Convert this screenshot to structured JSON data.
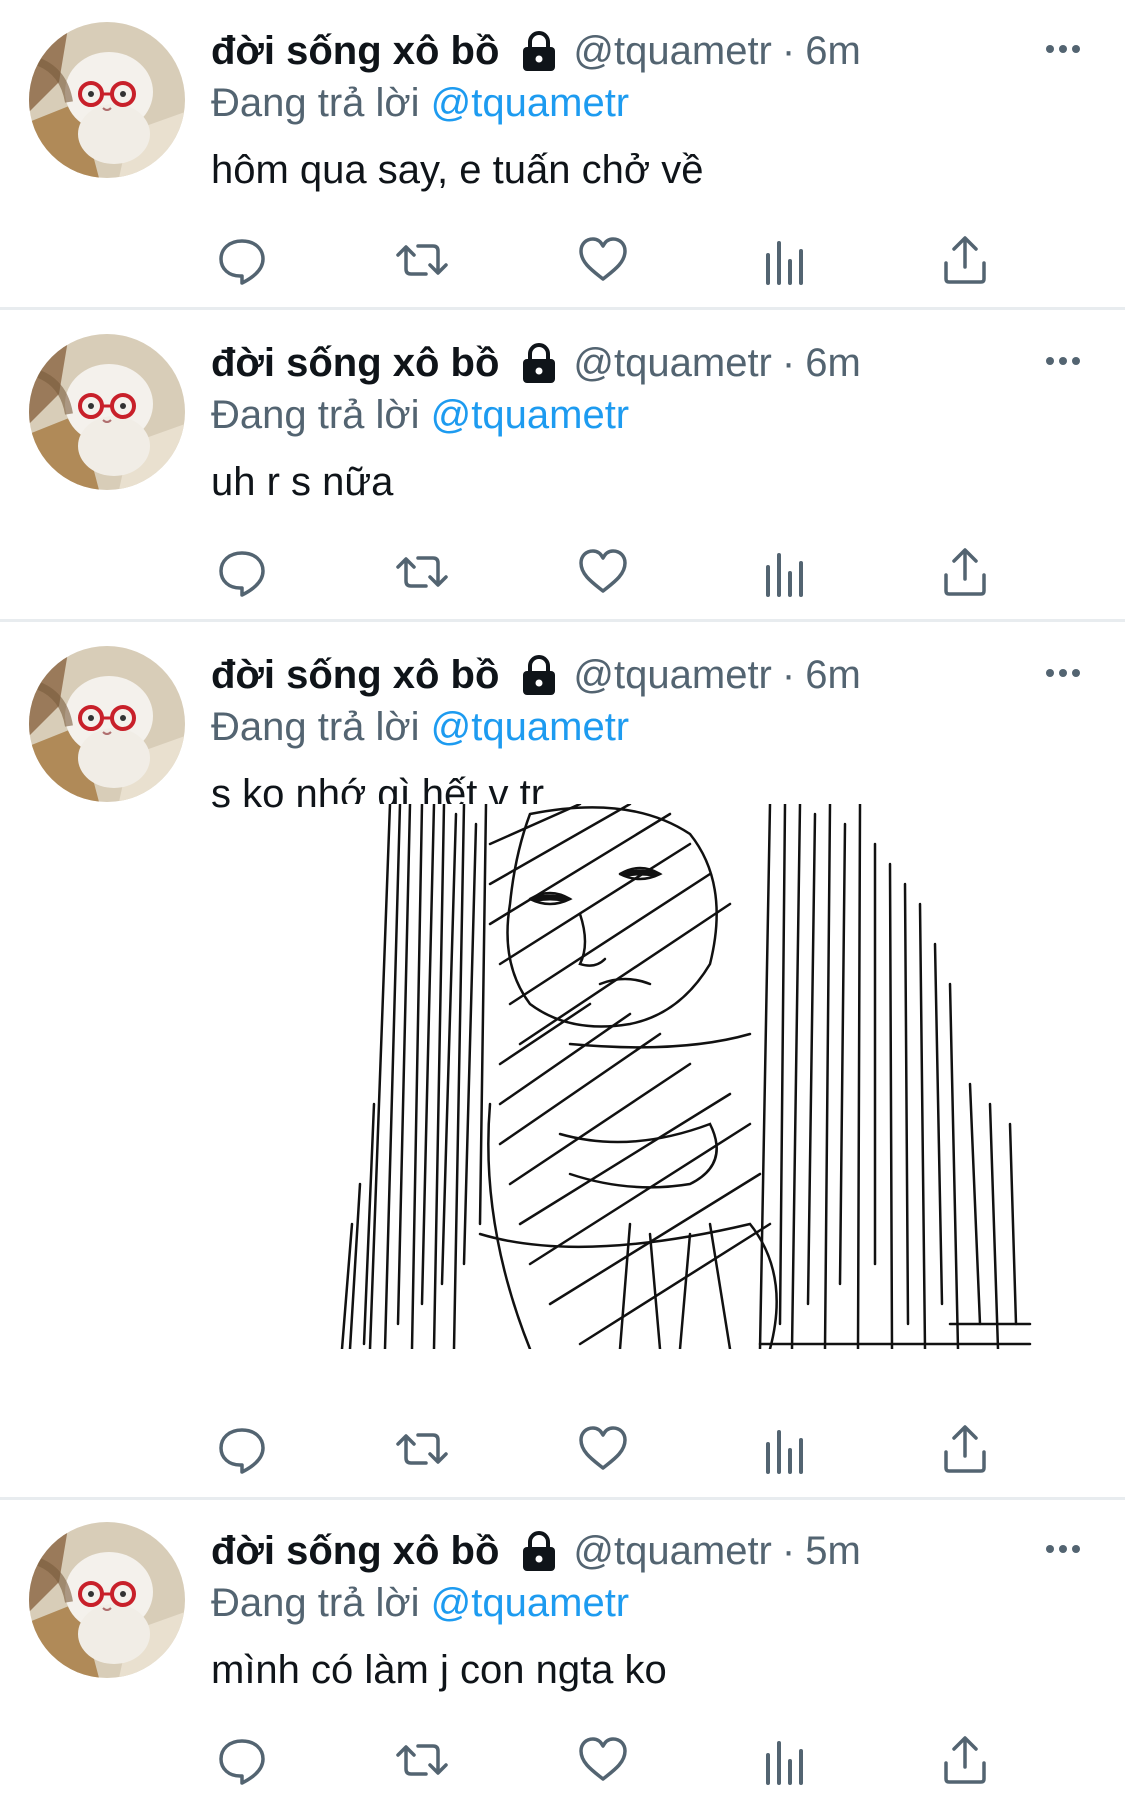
{
  "colors": {
    "text_primary": "#0f1419",
    "text_secondary": "#536471",
    "link_blue": "#1d9bf0",
    "divider": "#e8ecef"
  },
  "icons": {
    "lock": "lock-icon",
    "more": "more-icon",
    "reply": "reply-icon",
    "retweet": "retweet-icon",
    "like": "like-icon",
    "analytics": "analytics-icon",
    "share": "share-icon"
  },
  "tweets": [
    {
      "display_name": "đời sống xô bồ",
      "handle": "@tquametr",
      "separator": "·",
      "time": "6m",
      "reply_label": "Đang trả lời",
      "reply_to": "@tquametr",
      "text": "hôm qua say, e tuấn chở về"
    },
    {
      "display_name": "đời sống xô bồ",
      "handle": "@tquametr",
      "separator": "·",
      "time": "6m",
      "reply_label": "Đang trả lời",
      "reply_to": "@tquametr",
      "text": "uh r s nữa"
    },
    {
      "display_name": "đời sống xô bồ",
      "handle": "@tquametr",
      "separator": "·",
      "time": "6m",
      "reply_label": "Đang trả lời",
      "reply_to": "@tquametr",
      "text": "s ko nhớ gì hết v tr"
    },
    {
      "display_name": "đời sống xô bồ",
      "handle": "@tquametr",
      "separator": "·",
      "time": "5m",
      "reply_label": "Đang trả lời",
      "reply_to": "@tquametr",
      "text": "mình có làm j con ngta ko"
    }
  ]
}
